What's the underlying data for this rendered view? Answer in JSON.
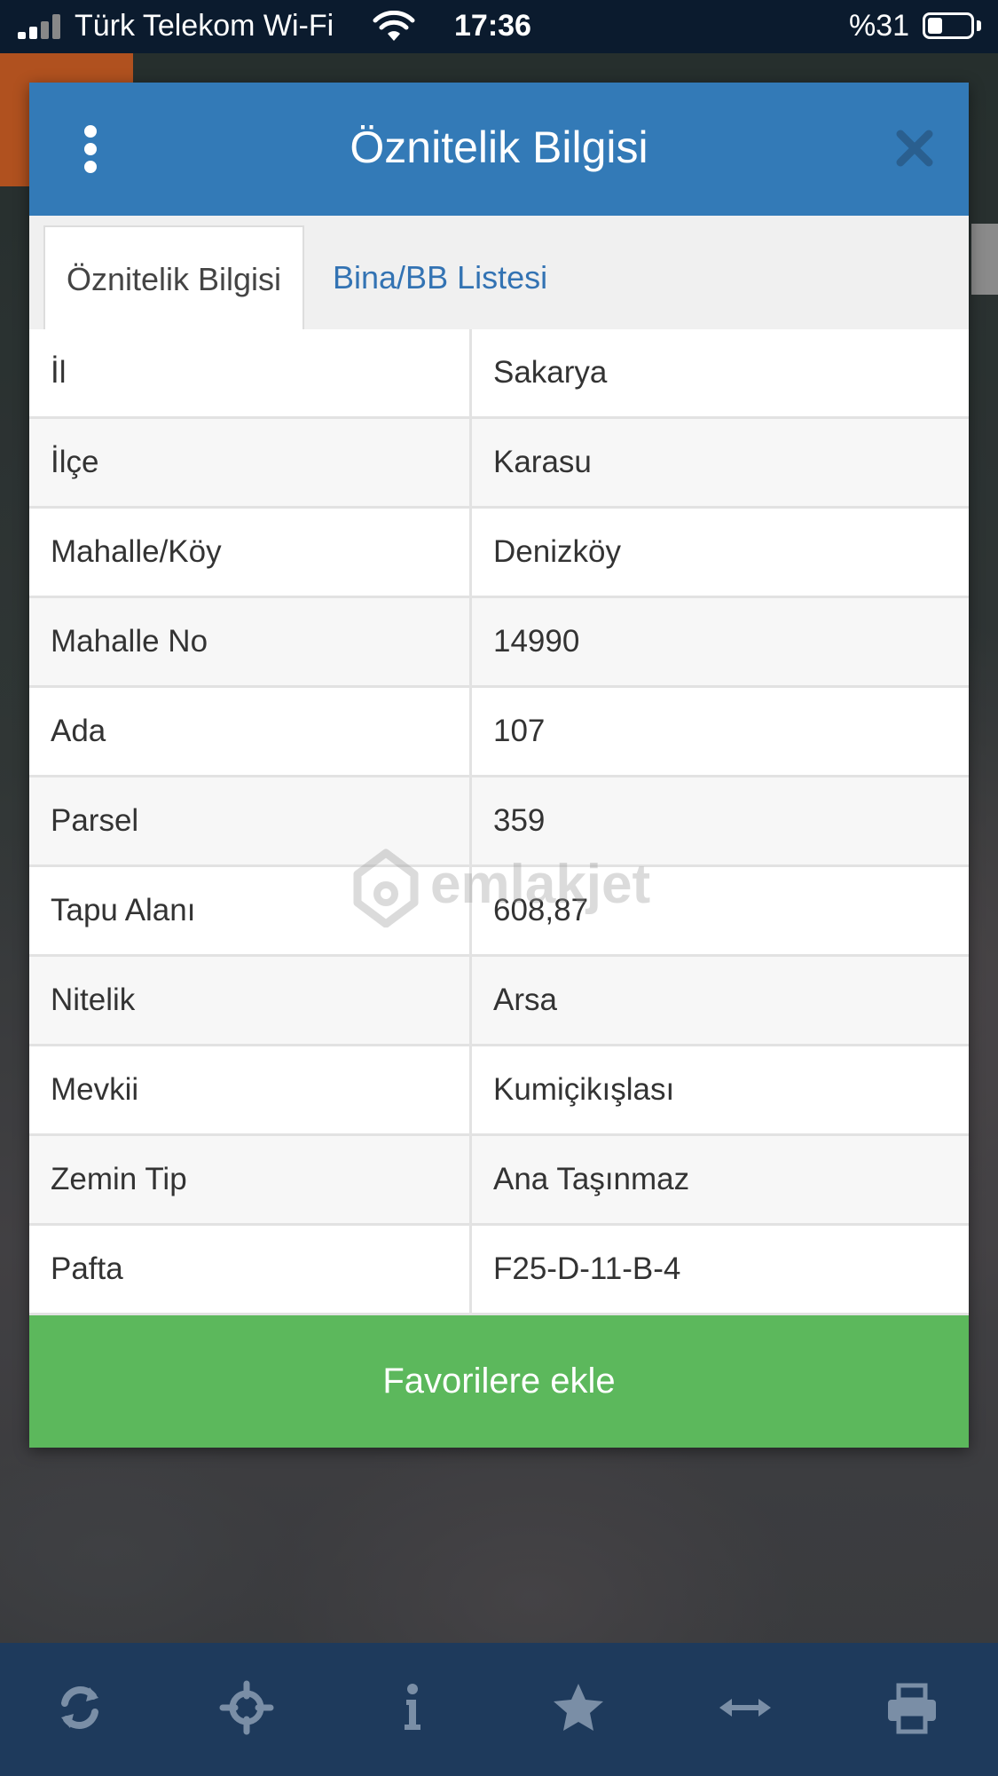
{
  "status_bar": {
    "carrier": "Türk Telekom Wi-Fi",
    "time": "17:36",
    "battery_percent": "%31",
    "battery_level": 0.31
  },
  "modal": {
    "title": "Öznitelik Bilgisi",
    "tabs": [
      {
        "label": "Öznitelik Bilgisi",
        "active": true
      },
      {
        "label": "Bina/BB Listesi",
        "active": false
      }
    ],
    "rows": [
      {
        "key": "İl",
        "value": "Sakarya"
      },
      {
        "key": "İlçe",
        "value": "Karasu"
      },
      {
        "key": "Mahalle/Köy",
        "value": "Denizköy"
      },
      {
        "key": "Mahalle No",
        "value": "14990"
      },
      {
        "key": "Ada",
        "value": "107"
      },
      {
        "key": "Parsel",
        "value": "359"
      },
      {
        "key": "Tapu Alanı",
        "value": "608,87"
      },
      {
        "key": "Nitelik",
        "value": "Arsa"
      },
      {
        "key": "Mevkii",
        "value": "Kumiçikışlası"
      },
      {
        "key": "Zemin Tip",
        "value": "Ana Taşınmaz"
      },
      {
        "key": "Pafta",
        "value": "F25-D-11-B-4"
      }
    ],
    "favorite_button": "Favorilere ekle"
  },
  "watermark": "emlakjet",
  "toolbar": {
    "icons": [
      "refresh-icon",
      "crosshair-icon",
      "info-icon",
      "star-icon",
      "measure-icon",
      "print-icon"
    ]
  },
  "colors": {
    "header": "#337ab7",
    "tab_link": "#3373b3",
    "button": "#5cb85c",
    "toolbar": "#1e3a5c",
    "status_bar": "#0b1b2e"
  }
}
